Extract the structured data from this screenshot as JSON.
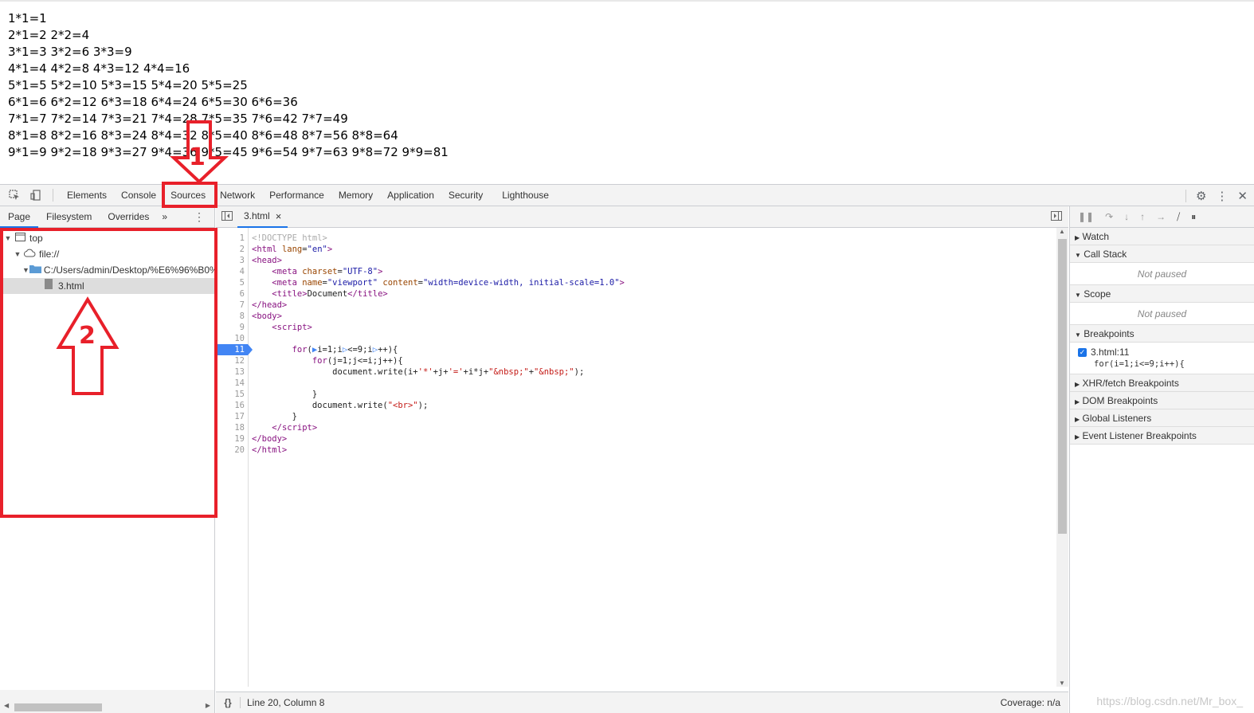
{
  "output": {
    "lines": [
      "1*1=1",
      "2*1=2 2*2=4",
      "3*1=3 3*2=6 3*3=9",
      "4*1=4 4*2=8 4*3=12 4*4=16",
      "5*1=5 5*2=10 5*3=15 5*4=20 5*5=25",
      "6*1=6 6*2=12 6*3=18 6*4=24 6*5=30 6*6=36",
      "7*1=7 7*2=14 7*3=21 7*4=28 7*5=35 7*6=42 7*7=49",
      "8*1=8 8*2=16 8*3=24 8*4=32 8*5=40 8*6=48 8*7=56 8*8=64",
      "9*1=9 9*2=18 9*3=27 9*4=36 9*5=45 9*6=54 9*7=63 9*8=72 9*9=81"
    ]
  },
  "devtools": {
    "tabs": [
      "Elements",
      "Console",
      "Sources",
      "Network",
      "Performance",
      "Memory",
      "Application",
      "Security",
      "Lighthouse"
    ],
    "active_tab": "Sources"
  },
  "navigator": {
    "tabs": [
      "Page",
      "Filesystem",
      "Overrides"
    ],
    "more": "»",
    "tree": {
      "top": "top",
      "origin": "file://",
      "folder": "C:/Users/admin/Desktop/%E6%96%B0%",
      "file": "3.html"
    }
  },
  "editor": {
    "file_tab": "3.html",
    "close_glyph": "×",
    "line_numbers": [
      "1",
      "2",
      "3",
      "4",
      "5",
      "6",
      "7",
      "8",
      "9",
      "10",
      "11",
      "12",
      "13",
      "14",
      "15",
      "16",
      "17",
      "18",
      "19",
      "20"
    ],
    "breakpoint_line": "11",
    "status_position": "Line 20, Column 8",
    "status_coverage": "Coverage: n/a",
    "format_glyph": "{}"
  },
  "debugger": {
    "watch": "Watch",
    "call_stack": "Call Stack",
    "not_paused": "Not paused",
    "scope": "Scope",
    "breakpoints": "Breakpoints",
    "bp_file": "3.html:11",
    "bp_code": "for(i=1;i<=9;i++){",
    "xhr": "XHR/fetch Breakpoints",
    "dom": "DOM Breakpoints",
    "global": "Global Listeners",
    "event": "Event Listener Breakpoints"
  },
  "annotations": {
    "label1": "1",
    "label2": "2"
  },
  "watermark": "https://blog.csdn.net/Mr_box_"
}
